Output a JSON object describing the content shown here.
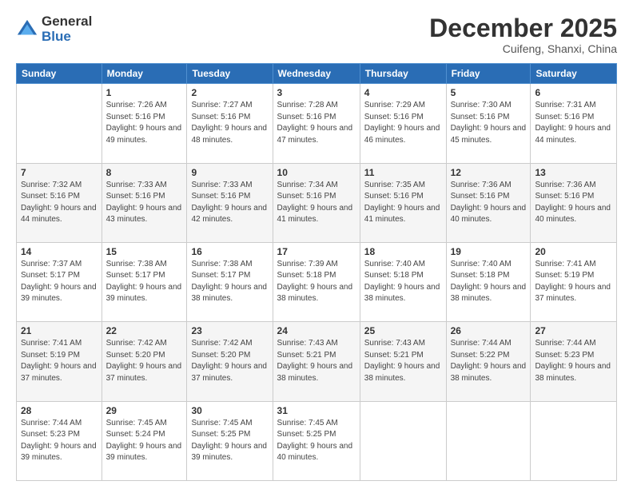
{
  "logo": {
    "general": "General",
    "blue": "Blue"
  },
  "header": {
    "month": "December 2025",
    "location": "Cuifeng, Shanxi, China"
  },
  "weekdays": [
    "Sunday",
    "Monday",
    "Tuesday",
    "Wednesday",
    "Thursday",
    "Friday",
    "Saturday"
  ],
  "weeks": [
    [
      {
        "day": "",
        "sunrise": "",
        "sunset": "",
        "daylight": ""
      },
      {
        "day": "1",
        "sunrise": "7:26 AM",
        "sunset": "5:16 PM",
        "daylight": "9 hours and 49 minutes."
      },
      {
        "day": "2",
        "sunrise": "7:27 AM",
        "sunset": "5:16 PM",
        "daylight": "9 hours and 48 minutes."
      },
      {
        "day": "3",
        "sunrise": "7:28 AM",
        "sunset": "5:16 PM",
        "daylight": "9 hours and 47 minutes."
      },
      {
        "day": "4",
        "sunrise": "7:29 AM",
        "sunset": "5:16 PM",
        "daylight": "9 hours and 46 minutes."
      },
      {
        "day": "5",
        "sunrise": "7:30 AM",
        "sunset": "5:16 PM",
        "daylight": "9 hours and 45 minutes."
      },
      {
        "day": "6",
        "sunrise": "7:31 AM",
        "sunset": "5:16 PM",
        "daylight": "9 hours and 44 minutes."
      }
    ],
    [
      {
        "day": "7",
        "sunrise": "7:32 AM",
        "sunset": "5:16 PM",
        "daylight": "9 hours and 44 minutes."
      },
      {
        "day": "8",
        "sunrise": "7:33 AM",
        "sunset": "5:16 PM",
        "daylight": "9 hours and 43 minutes."
      },
      {
        "day": "9",
        "sunrise": "7:33 AM",
        "sunset": "5:16 PM",
        "daylight": "9 hours and 42 minutes."
      },
      {
        "day": "10",
        "sunrise": "7:34 AM",
        "sunset": "5:16 PM",
        "daylight": "9 hours and 41 minutes."
      },
      {
        "day": "11",
        "sunrise": "7:35 AM",
        "sunset": "5:16 PM",
        "daylight": "9 hours and 41 minutes."
      },
      {
        "day": "12",
        "sunrise": "7:36 AM",
        "sunset": "5:16 PM",
        "daylight": "9 hours and 40 minutes."
      },
      {
        "day": "13",
        "sunrise": "7:36 AM",
        "sunset": "5:16 PM",
        "daylight": "9 hours and 40 minutes."
      }
    ],
    [
      {
        "day": "14",
        "sunrise": "7:37 AM",
        "sunset": "5:17 PM",
        "daylight": "9 hours and 39 minutes."
      },
      {
        "day": "15",
        "sunrise": "7:38 AM",
        "sunset": "5:17 PM",
        "daylight": "9 hours and 39 minutes."
      },
      {
        "day": "16",
        "sunrise": "7:38 AM",
        "sunset": "5:17 PM",
        "daylight": "9 hours and 38 minutes."
      },
      {
        "day": "17",
        "sunrise": "7:39 AM",
        "sunset": "5:18 PM",
        "daylight": "9 hours and 38 minutes."
      },
      {
        "day": "18",
        "sunrise": "7:40 AM",
        "sunset": "5:18 PM",
        "daylight": "9 hours and 38 minutes."
      },
      {
        "day": "19",
        "sunrise": "7:40 AM",
        "sunset": "5:18 PM",
        "daylight": "9 hours and 38 minutes."
      },
      {
        "day": "20",
        "sunrise": "7:41 AM",
        "sunset": "5:19 PM",
        "daylight": "9 hours and 37 minutes."
      }
    ],
    [
      {
        "day": "21",
        "sunrise": "7:41 AM",
        "sunset": "5:19 PM",
        "daylight": "9 hours and 37 minutes."
      },
      {
        "day": "22",
        "sunrise": "7:42 AM",
        "sunset": "5:20 PM",
        "daylight": "9 hours and 37 minutes."
      },
      {
        "day": "23",
        "sunrise": "7:42 AM",
        "sunset": "5:20 PM",
        "daylight": "9 hours and 37 minutes."
      },
      {
        "day": "24",
        "sunrise": "7:43 AM",
        "sunset": "5:21 PM",
        "daylight": "9 hours and 38 minutes."
      },
      {
        "day": "25",
        "sunrise": "7:43 AM",
        "sunset": "5:21 PM",
        "daylight": "9 hours and 38 minutes."
      },
      {
        "day": "26",
        "sunrise": "7:44 AM",
        "sunset": "5:22 PM",
        "daylight": "9 hours and 38 minutes."
      },
      {
        "day": "27",
        "sunrise": "7:44 AM",
        "sunset": "5:23 PM",
        "daylight": "9 hours and 38 minutes."
      }
    ],
    [
      {
        "day": "28",
        "sunrise": "7:44 AM",
        "sunset": "5:23 PM",
        "daylight": "9 hours and 39 minutes."
      },
      {
        "day": "29",
        "sunrise": "7:45 AM",
        "sunset": "5:24 PM",
        "daylight": "9 hours and 39 minutes."
      },
      {
        "day": "30",
        "sunrise": "7:45 AM",
        "sunset": "5:25 PM",
        "daylight": "9 hours and 39 minutes."
      },
      {
        "day": "31",
        "sunrise": "7:45 AM",
        "sunset": "5:25 PM",
        "daylight": "9 hours and 40 minutes."
      },
      {
        "day": "",
        "sunrise": "",
        "sunset": "",
        "daylight": ""
      },
      {
        "day": "",
        "sunrise": "",
        "sunset": "",
        "daylight": ""
      },
      {
        "day": "",
        "sunrise": "",
        "sunset": "",
        "daylight": ""
      }
    ]
  ]
}
